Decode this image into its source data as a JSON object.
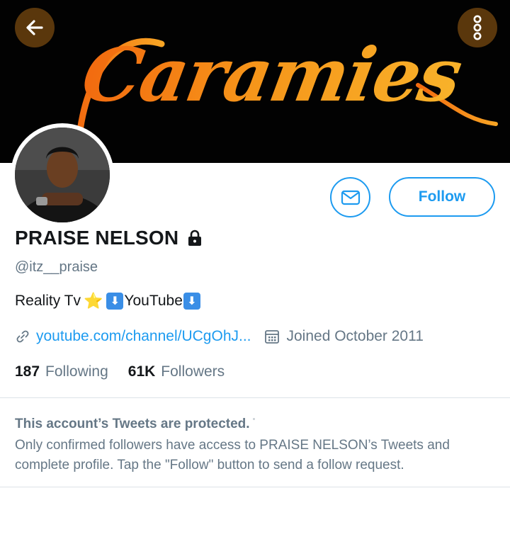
{
  "header": {
    "banner_text": "Caramies",
    "back_icon": "arrow-left-icon",
    "more_icon": "more-vertical-icon"
  },
  "profile": {
    "display_name": "PRAISE NELSON",
    "handle": "@itz__praise",
    "bio": {
      "text_start": "Reality Tv",
      "star_emoji": "⭐",
      "arrow_emoji": "⬇",
      "text_middle": "YouTube"
    },
    "link": "youtube.com/channel/UCgOhJ...",
    "joined": "Joined October 2011",
    "following_count": "187",
    "following_label": "Following",
    "followers_count": "61K",
    "followers_label": "Followers"
  },
  "actions": {
    "message_icon": "envelope-icon",
    "follow_label": "Follow"
  },
  "protected": {
    "title": "This account’s Tweets are protected.",
    "body": "Only confirmed followers have access to PRAISE NELSON’s Tweets and complete profile. Tap the \"Follow\" button to send a follow request."
  },
  "colors": {
    "accent": "#1d9bf0",
    "banner_bg": "#020202",
    "button_overlay": "#5a370c",
    "banner_text_start": "#f26a0f",
    "banner_text_end": "#f8b22a",
    "secondary_text": "#657786"
  }
}
